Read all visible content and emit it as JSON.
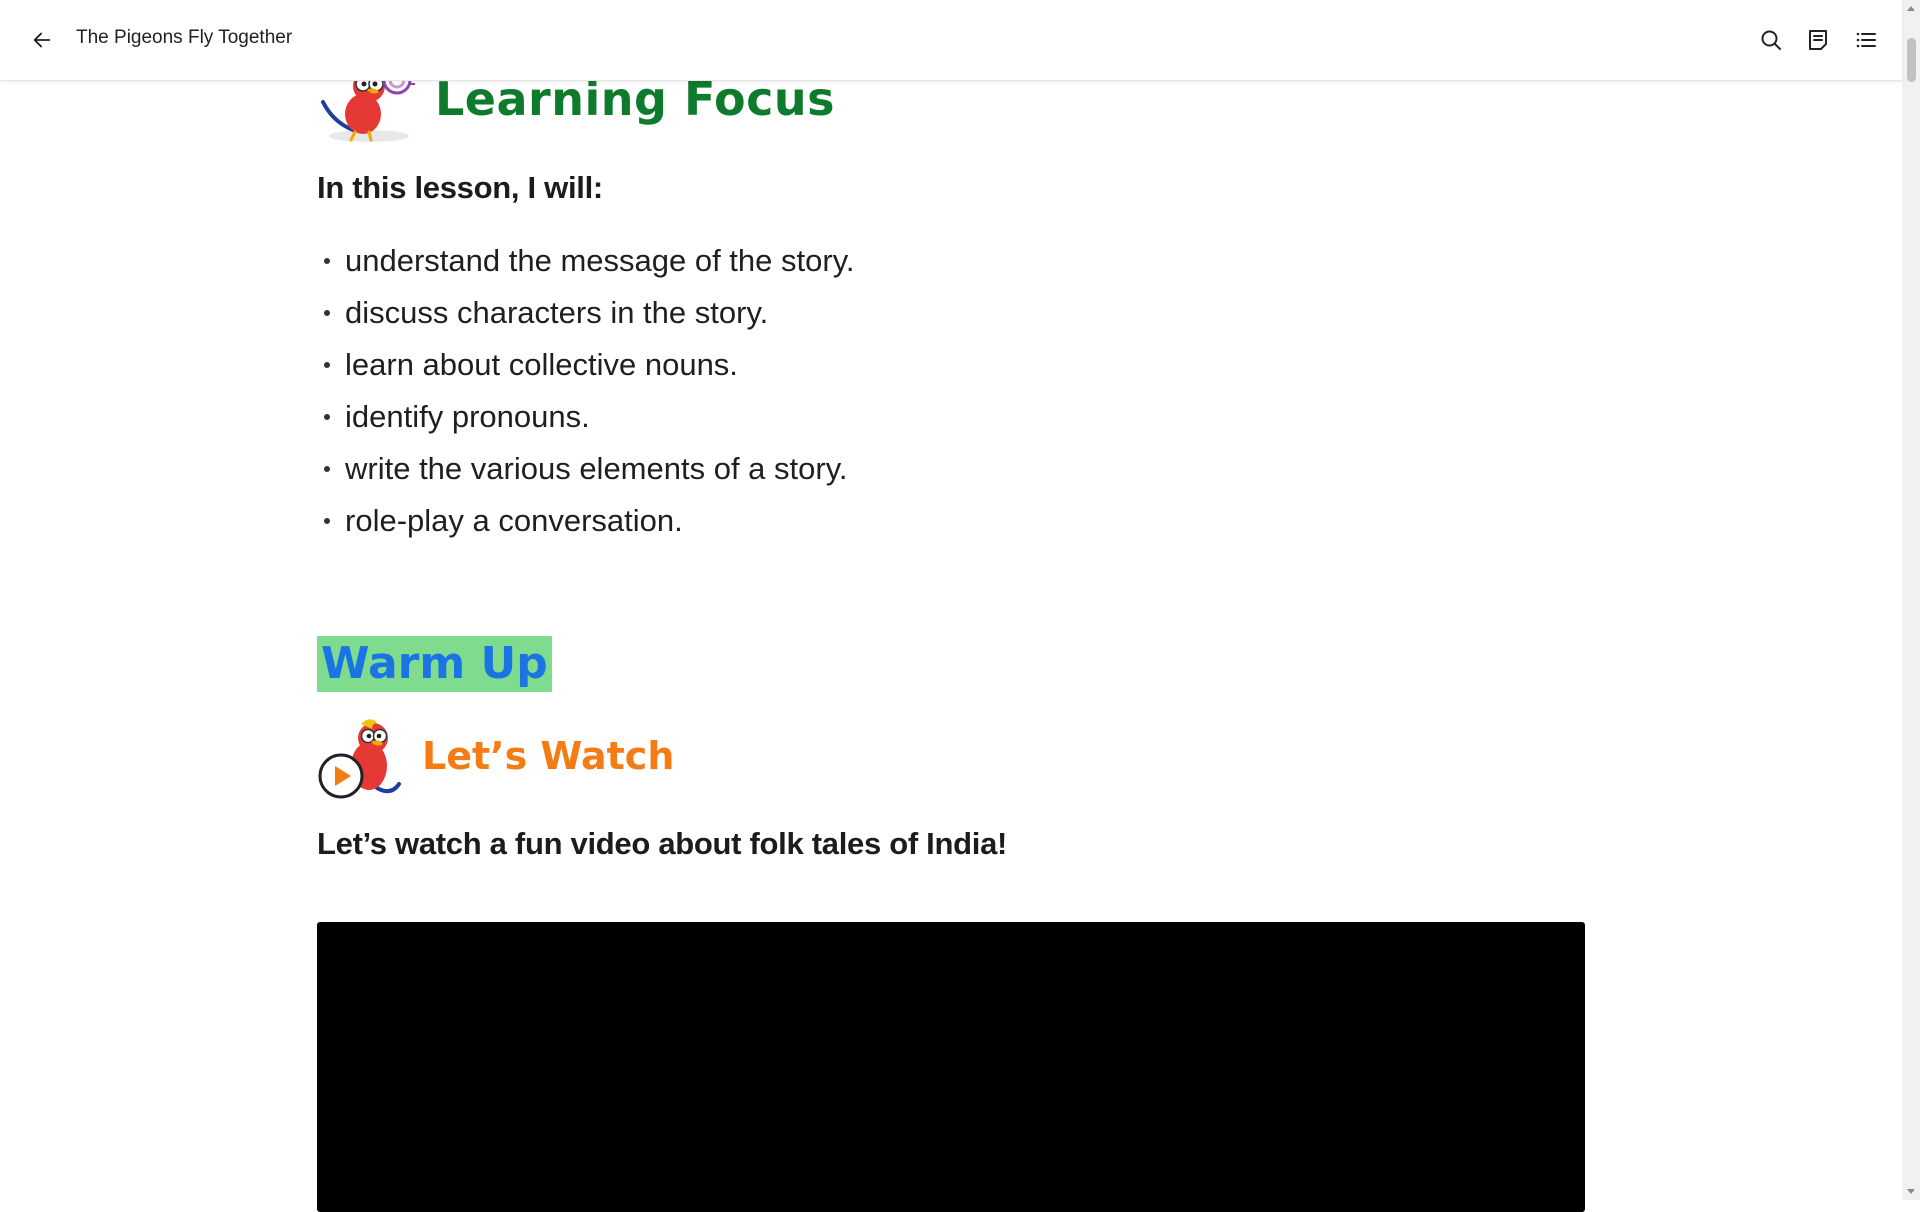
{
  "header": {
    "back_icon": "arrow-left-icon",
    "title": "The Pigeons Fly Together",
    "actions": [
      {
        "name": "search",
        "icon": "search-icon"
      },
      {
        "name": "notes",
        "icon": "notes-icon"
      },
      {
        "name": "table-of-contents",
        "icon": "list-icon"
      }
    ]
  },
  "learning_focus": {
    "heading": "Learning Focus",
    "heading_color": "#0e7a2c",
    "intro": "In this lesson, I will:",
    "goals": [
      "understand the message of the story.",
      "discuss characters in the story.",
      "learn about collective nouns.",
      "identify pronouns.",
      "write the various elements of a story.",
      "role-play a conversation."
    ]
  },
  "warm_up": {
    "heading": "Warm Up",
    "text_color": "#1b74e4",
    "highlight_color": "#7fdc8e"
  },
  "lets_watch": {
    "heading": "Let’s Watch",
    "heading_color": "#f57c14",
    "intro": "Let’s watch a fun video about folk tales of India!"
  },
  "colors": {
    "mascot_red": "#e53935",
    "video_background": "#000000"
  }
}
